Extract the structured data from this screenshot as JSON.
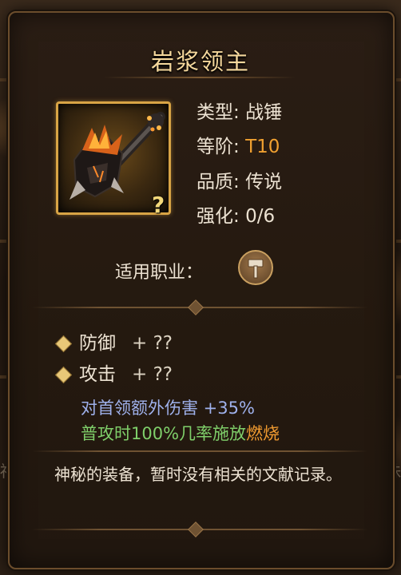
{
  "item": {
    "name": "岩浆领主",
    "attributes": [
      {
        "label": "类型:",
        "value": "战锤"
      },
      {
        "label": "等阶:",
        "value": "T10"
      },
      {
        "label": "品质:",
        "value": "传说"
      },
      {
        "label": "强化:",
        "value": "0/6"
      }
    ],
    "job_label": "适用职业：",
    "job_icon": "hammer-icon",
    "stats": [
      {
        "name": "防御",
        "value": "+ ??"
      },
      {
        "name": "攻击",
        "value": "+ ??"
      }
    ],
    "bonus_boss": "对首领额外伤害 +35%",
    "bonus_proc_prefix": "普攻时100%几率施放",
    "bonus_proc_effect": "燃烧",
    "description": "神秘的装备，暂时没有相关的文献记录。",
    "help_mark": "?"
  },
  "background": {
    "left_text": "福",
    "right_text": "珠"
  },
  "colors": {
    "title": "#f5d89c",
    "orange": "#f0a030",
    "blue_bonus": "#9fb1ec",
    "green_bonus": "#7fcf6a",
    "frame_gold": "#d8a445"
  }
}
